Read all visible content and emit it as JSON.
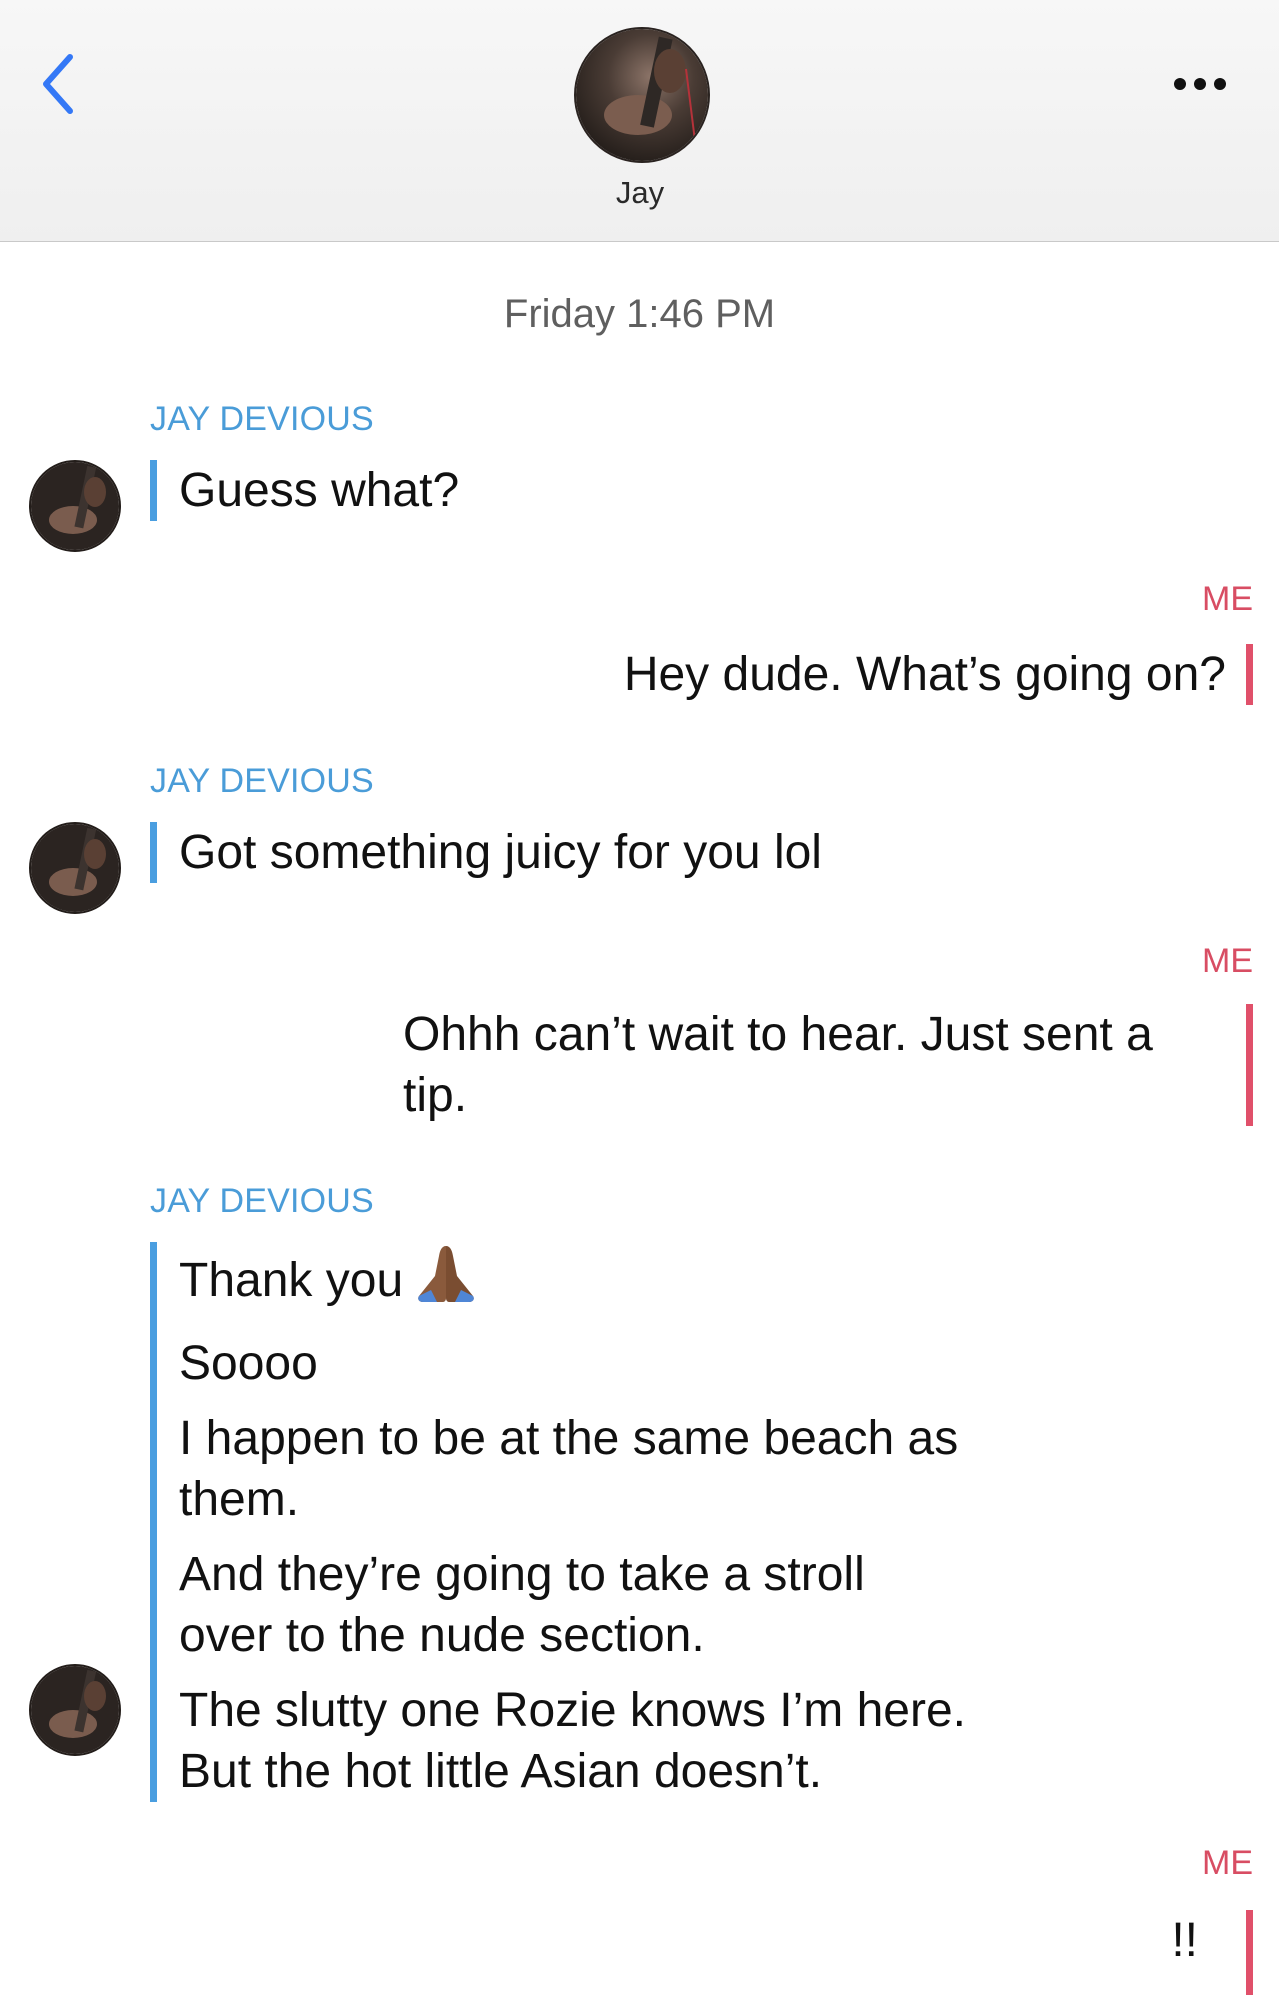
{
  "header": {
    "contact_name": "Jay",
    "back_icon": "chevron-left-icon",
    "more_icon": "more-horizontal-icon",
    "accent_color": "#3478f6"
  },
  "timestamp": "Friday 1:46 PM",
  "colors": {
    "incoming_bar": "#4a9ee0",
    "outgoing_bar": "#e0506a",
    "incoming_sender": "#4a9cd8",
    "outgoing_sender": "#d84d63"
  },
  "messages": [
    {
      "sender": "JAY DEVIOUS",
      "direction": "incoming",
      "lines": [
        "Guess what?"
      ]
    },
    {
      "sender": "ME",
      "direction": "outgoing",
      "lines": [
        "Hey dude. What’s going on?"
      ]
    },
    {
      "sender": "JAY DEVIOUS",
      "direction": "incoming",
      "lines": [
        "Got something juicy for you lol"
      ]
    },
    {
      "sender": "ME",
      "direction": "outgoing",
      "lines": [
        "Ohhh can’t wait to hear. Just sent a tip."
      ]
    },
    {
      "sender": "JAY DEVIOUS",
      "direction": "incoming",
      "lines": [
        "Thank you",
        "Soooo",
        "I happen to be at the same beach as them.",
        "And they’re going to take a stroll over to the nude section.",
        "The slutty one Rozie knows I’m here. But the hot little Asian doesn’t."
      ],
      "emoji_after_first_line": "folded-hands-icon"
    },
    {
      "sender": "ME",
      "direction": "outgoing",
      "lines": [
        "!!"
      ]
    }
  ]
}
